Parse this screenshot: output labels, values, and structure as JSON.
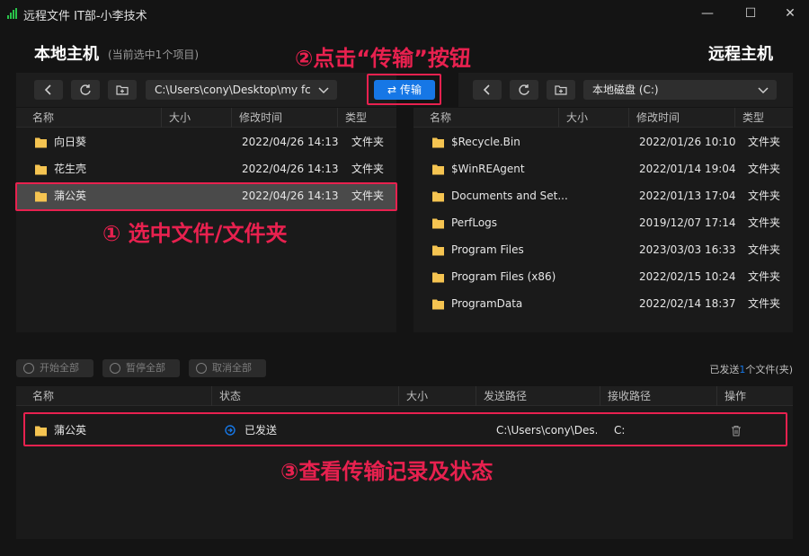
{
  "window": {
    "title": "远程文件 IT部-小李技术",
    "minimize_glyph": "—",
    "maximize_glyph": "☐",
    "close_glyph": "✕"
  },
  "local": {
    "title": "本地主机",
    "subtitle": "(当前选中1个项目)",
    "path": "C:\\Users\\cony\\Desktop\\my fc",
    "columns": [
      "名称",
      "大小",
      "修改时间",
      "类型"
    ],
    "rows": [
      {
        "name": "向日葵",
        "size": "",
        "mtime": "2022/04/26 14:13",
        "type": "文件夹"
      },
      {
        "name": "花生壳",
        "size": "",
        "mtime": "2022/04/26 14:13",
        "type": "文件夹"
      },
      {
        "name": "蒲公英",
        "size": "",
        "mtime": "2022/04/26 14:13",
        "type": "文件夹"
      }
    ],
    "selected_index": 2
  },
  "remote": {
    "title": "远程主机",
    "path": "本地磁盘 (C:)",
    "columns": [
      "名称",
      "大小",
      "修改时间",
      "类型"
    ],
    "rows": [
      {
        "name": "$Recycle.Bin",
        "size": "",
        "mtime": "2022/01/26 10:10",
        "type": "文件夹"
      },
      {
        "name": "$WinREAgent",
        "size": "",
        "mtime": "2022/01/14 19:04",
        "type": "文件夹"
      },
      {
        "name": "Documents and Set...",
        "size": "",
        "mtime": "2022/01/13 17:04",
        "type": "文件夹"
      },
      {
        "name": "PerfLogs",
        "size": "",
        "mtime": "2019/12/07 17:14",
        "type": "文件夹"
      },
      {
        "name": "Program Files",
        "size": "",
        "mtime": "2023/03/03 16:33",
        "type": "文件夹"
      },
      {
        "name": "Program Files (x86)",
        "size": "",
        "mtime": "2022/02/15 10:24",
        "type": "文件夹"
      },
      {
        "name": "ProgramData",
        "size": "",
        "mtime": "2022/02/14 18:37",
        "type": "文件夹"
      }
    ]
  },
  "transfer_button": {
    "label": "传输",
    "icon": "swap-arrows-icon"
  },
  "tasks": {
    "start_all": "开始全部",
    "pause_all": "暂停全部",
    "cancel_all": "取消全部",
    "summary_prefix": "已发送",
    "summary_count": "1",
    "summary_suffix": "个文件(夹)",
    "columns": [
      "名称",
      "状态",
      "大小",
      "发送路径",
      "接收路径",
      "操作"
    ],
    "rows": [
      {
        "name": "蒲公英",
        "status": "已发送",
        "size": "",
        "send_path": "C:\\Users\\cony\\Des...",
        "recv_path": "C:"
      }
    ]
  },
  "annotations": {
    "step1": "① 选中文件/文件夹",
    "step2": "②点击“传输”按钮",
    "step3": "③查看传输记录及状态"
  },
  "colors": {
    "accent": "#1677e6",
    "annotation": "#e8214f",
    "folder": "#f5c451",
    "app_icon": "#29c44a"
  }
}
